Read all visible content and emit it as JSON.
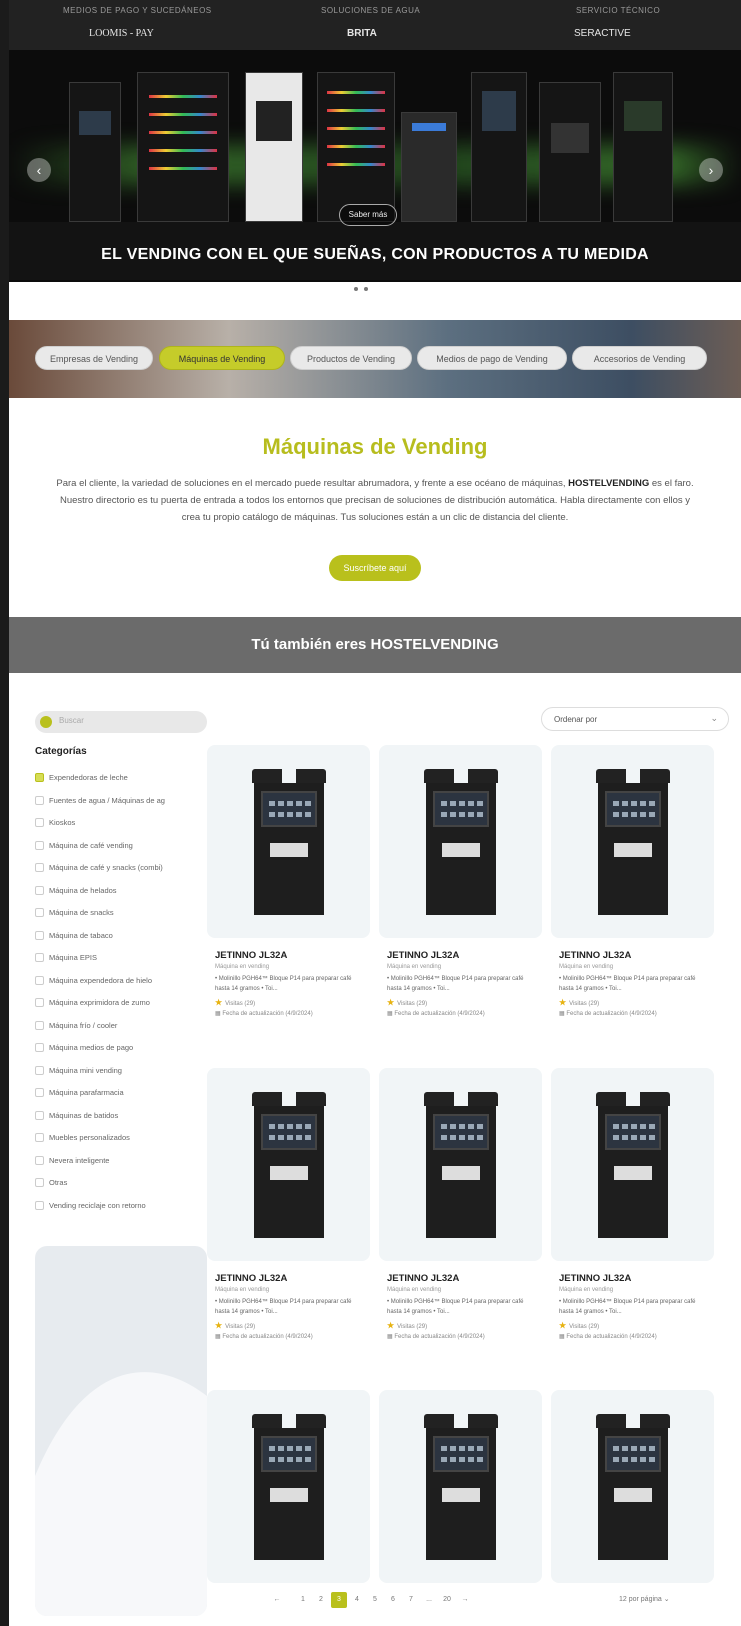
{
  "top_categories": [
    "MEDIOS DE PAGO Y SUCEDÁNEOS",
    "SOLUCIONES DE AGUA",
    "SERVICIO TÉCNICO"
  ],
  "brands": [
    "LOOMIS - PAY",
    "BRITA",
    "SERACTIVE"
  ],
  "hero": {
    "title": "EL VENDING CON EL QUE SUEÑAS, CON PRODUCTOS A TU MEDIDA",
    "button": "Saber más",
    "prev": "‹",
    "next": "›"
  },
  "category_chips": [
    {
      "label": "Empresas de Vending",
      "active": false
    },
    {
      "label": "Máquinas de Vending",
      "active": true
    },
    {
      "label": "Productos de Vending",
      "active": false
    },
    {
      "label": "Medios de pago de Vending",
      "active": false
    },
    {
      "label": "Accesorios de Vending",
      "active": false
    }
  ],
  "intro": {
    "title": "Máquinas de Vending",
    "text_before": "Para el cliente, la variedad de soluciones en el mercado puede resultar abrumadora, y frente a ese océano de máquinas, ",
    "brand": "HOSTELVENDING",
    "text_after": " es el faro. Nuestro directorio es tu puerta de entrada a todos los entornos que precisan de soluciones de distribución automática. Habla directamente con ellos y crea tu propio catálogo de máquinas. Tus soluciones están a un clic de distancia del cliente.",
    "button": "Suscríbete aquí"
  },
  "band_title": "Tú también eres HOSTELVENDING",
  "sidebar": {
    "search_placeholder": "Buscar",
    "categories_title": "Categorías",
    "categories": [
      {
        "label": "Expendedoras de leche",
        "checked": true
      },
      {
        "label": "Fuentes de agua / Máquinas de ag",
        "checked": false
      },
      {
        "label": "Kioskos",
        "checked": false
      },
      {
        "label": "Máquina de café vending",
        "checked": false
      },
      {
        "label": "Máquina de café y snacks (combi)",
        "checked": false
      },
      {
        "label": "Máquina de helados",
        "checked": false
      },
      {
        "label": "Máquina de snacks",
        "checked": false
      },
      {
        "label": "Máquina de tabaco",
        "checked": false
      },
      {
        "label": "Máquina EPIS",
        "checked": false
      },
      {
        "label": "Máquina expendedora de hielo",
        "checked": false
      },
      {
        "label": "Máquina exprimidora de zumo",
        "checked": false
      },
      {
        "label": "Máquina frío / cooler",
        "checked": false
      },
      {
        "label": "Máquina medios de pago",
        "checked": false
      },
      {
        "label": "Máquina mini vending",
        "checked": false
      },
      {
        "label": "Máquina parafarmacia",
        "checked": false
      },
      {
        "label": "Máquinas de batidos",
        "checked": false
      },
      {
        "label": "Muebles personalizados",
        "checked": false
      },
      {
        "label": "Nevera inteligente",
        "checked": false
      },
      {
        "label": "Otras",
        "checked": false
      },
      {
        "label": "Vending reciclaje con retorno",
        "checked": false
      }
    ]
  },
  "sort_label": "Ordenar por",
  "products": [
    {
      "title": "JETINNO JL32A",
      "subtitle": "Máquina en vending",
      "desc": "• Molinillo PGH64™ Bloque P14 para preparar café hasta 14 gramos • Toi...",
      "views": "Visitas (29)",
      "updated": "Fecha de actualización (4/9/2024)"
    },
    {
      "title": "JETINNO JL32A",
      "subtitle": "Máquina en vending",
      "desc": "• Molinillo PGH64™ Bloque P14 para preparar café hasta 14 gramos • Toi...",
      "views": "Visitas (29)",
      "updated": "Fecha de actualización (4/9/2024)"
    },
    {
      "title": "JETINNO JL32A",
      "subtitle": "Máquina en vending",
      "desc": "• Molinillo PGH64™ Bloque P14 para preparar café hasta 14 gramos • Toi...",
      "views": "Visitas (29)",
      "updated": "Fecha de actualización (4/9/2024)"
    },
    {
      "title": "JETINNO JL32A",
      "subtitle": "Máquina en vending",
      "desc": "• Molinillo PGH64™ Bloque P14 para preparar café hasta 14 gramos • Toi...",
      "views": "Visitas (29)",
      "updated": "Fecha de actualización (4/9/2024)"
    },
    {
      "title": "JETINNO JL32A",
      "subtitle": "Máquina en vending",
      "desc": "• Molinillo PGH64™ Bloque P14 para preparar café hasta 14 gramos • Toi...",
      "views": "Visitas (29)",
      "updated": "Fecha de actualización (4/9/2024)"
    },
    {
      "title": "JETINNO JL32A",
      "subtitle": "Máquina en vending",
      "desc": "• Molinillo PGH64™ Bloque P14 para preparar café hasta 14 gramos • Toi...",
      "views": "Visitas (29)",
      "updated": "Fecha de actualización (4/9/2024)"
    },
    {
      "title": "",
      "subtitle": "",
      "desc": "",
      "views": "",
      "updated": ""
    },
    {
      "title": "",
      "subtitle": "",
      "desc": "",
      "views": "",
      "updated": ""
    },
    {
      "title": "",
      "subtitle": "",
      "desc": "",
      "views": "",
      "updated": ""
    }
  ],
  "pagination": {
    "prev": "←",
    "pages": [
      "1",
      "2",
      "3",
      "4",
      "5",
      "6",
      "7",
      "...",
      "20"
    ],
    "current": "3",
    "next": "→",
    "per_page": "12 por página"
  },
  "colors": {
    "accent": "#b9c01c",
    "band": "#6b6b6b"
  }
}
